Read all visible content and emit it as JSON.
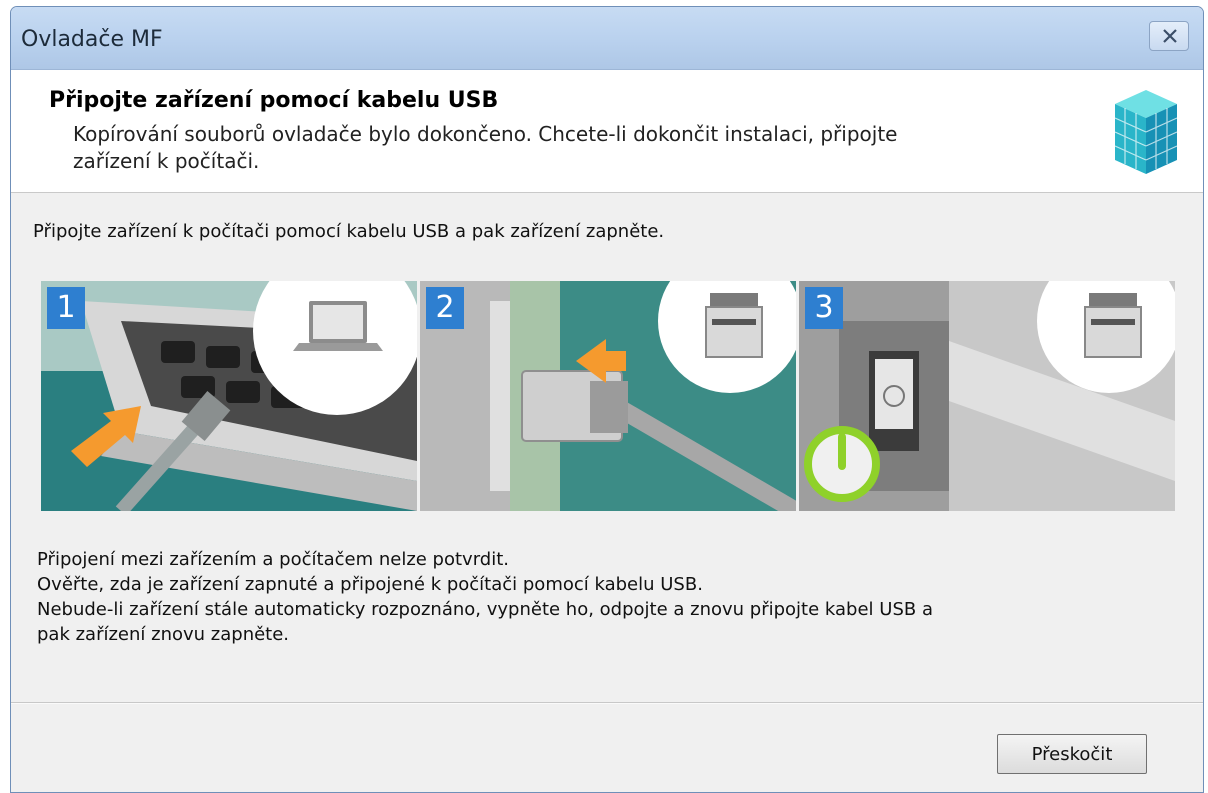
{
  "window": {
    "title": "Ovladače MF",
    "close_icon": "close-icon"
  },
  "header": {
    "title": "Připojte zařízení pomocí kabelu USB",
    "description": "Kopírování souborů ovladače bylo dokončeno. Chcete-li dokončit instalaci, připojte zařízení k počítači.",
    "logo_icon": "cube-logo-icon"
  },
  "main": {
    "instruction": "Připojte zařízení k počítači pomocí kabelu USB a pak zařízení zapněte.",
    "steps": [
      {
        "number": "1",
        "icon": "laptop-usb-illustration"
      },
      {
        "number": "2",
        "icon": "printer-usb-illustration"
      },
      {
        "number": "3",
        "icon": "power-switch-illustration"
      }
    ],
    "status_lines": [
      "Připojení mezi zařízením a počítačem nelze potvrdit.",
      "Ověřte, zda je zařízení zapnuté a připojené k počítači pomocí kabelu USB.",
      "Nebude-li zařízení stále automaticky rozpoznáno, vypněte ho, odpojte a znovu připojte kabel USB a",
      "pak zařízení znovu zapněte."
    ]
  },
  "footer": {
    "skip_label": "Přeskočit"
  },
  "colors": {
    "step_badge": "#2e7fd0",
    "titlebar": "#b9d1ee",
    "power_green": "#8fd12a",
    "arrow_orange": "#f59a2e"
  }
}
